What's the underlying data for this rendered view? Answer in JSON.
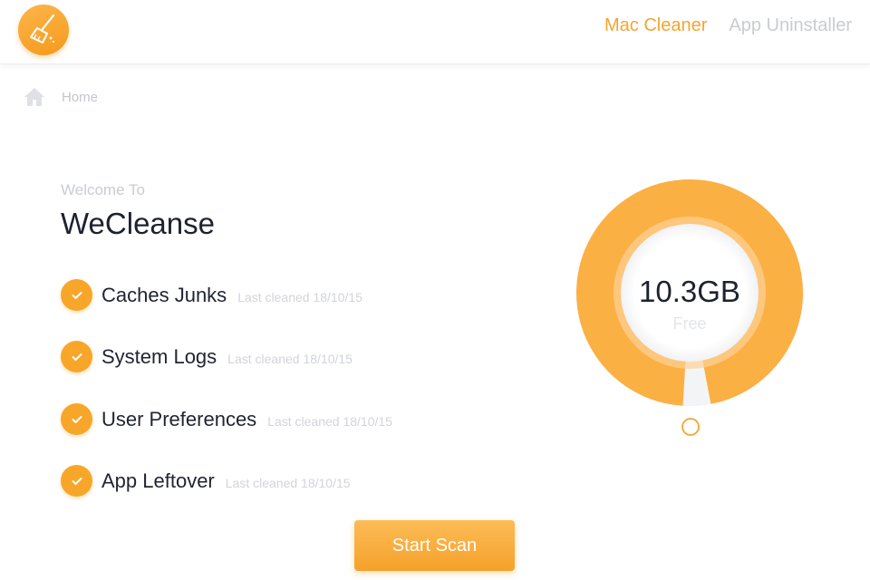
{
  "header": {
    "logo_icon": "broom-icon",
    "tabs": [
      {
        "label": "Mac Cleaner",
        "active": true
      },
      {
        "label": "App Uninstaller",
        "active": false
      }
    ]
  },
  "breadcrumb": {
    "icon": "home-icon",
    "label": "Home"
  },
  "welcome": {
    "subtitle": "Welcome To",
    "title": "WeCleanse"
  },
  "items": [
    {
      "name": "Caches Junks",
      "last_cleaned": "Last cleaned 18/10/15"
    },
    {
      "name": "System Logs",
      "last_cleaned": "Last cleaned 18/10/15"
    },
    {
      "name": "User Preferences",
      "last_cleaned": "Last cleaned 18/10/15"
    },
    {
      "name": "App Leftover",
      "last_cleaned": "Last cleaned 18/10/15"
    }
  ],
  "storage": {
    "value": "10.3GB",
    "label": "Free",
    "used_fraction": 0.97
  },
  "actions": {
    "scan_label": "Start Scan"
  },
  "colors": {
    "accent": "#f5a431",
    "muted": "#c9ccd2"
  }
}
